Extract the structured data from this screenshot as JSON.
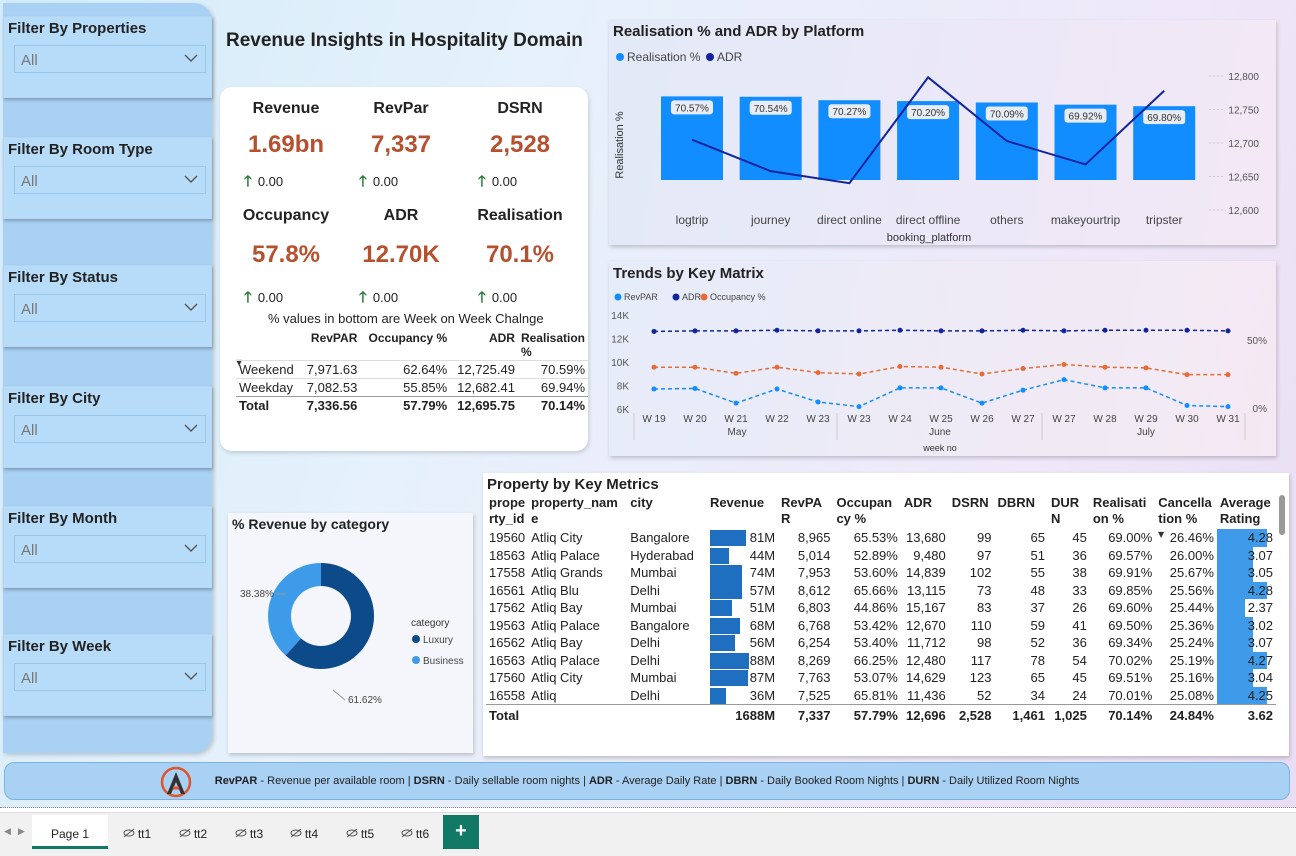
{
  "title": "Revenue Insights in Hospitality Domain",
  "filters": [
    {
      "label": "Filter By Properties",
      "value": "All"
    },
    {
      "label": "Filter By Room Type",
      "value": "All"
    },
    {
      "label": "Filter By Status",
      "value": "All"
    },
    {
      "label": "Filter By City",
      "value": "All"
    },
    {
      "label": "Filter By Month",
      "value": "All"
    },
    {
      "label": "Filter By Week",
      "value": "All"
    }
  ],
  "kpis": [
    {
      "label": "Revenue",
      "value": "1.69bn",
      "change": "0.00"
    },
    {
      "label": "RevPar",
      "value": "7,337",
      "change": "0.00"
    },
    {
      "label": "DSRN",
      "value": "2,528",
      "change": "0.00"
    },
    {
      "label": "Occupancy",
      "value": "57.8%",
      "change": "0.00"
    },
    {
      "label": "ADR",
      "value": "12.70K",
      "change": "0.00"
    },
    {
      "label": "Realisation",
      "value": "70.1%",
      "change": "0.00"
    }
  ],
  "kpi_note": "% values in bottom are Week on Week Chalnge",
  "daytype_table": {
    "headers": [
      "",
      "RevPAR",
      "Occupancy %",
      "ADR",
      "Realisation %"
    ],
    "rows": [
      [
        "Weekend",
        "7,971.63",
        "62.64%",
        "12,725.49",
        "70.59%"
      ],
      [
        "Weekday",
        "7,082.53",
        "55.85%",
        "12,682.41",
        "69.94%"
      ]
    ],
    "total": [
      "Total",
      "7,336.56",
      "57.79%",
      "12,695.75",
      "70.14%"
    ]
  },
  "colors": {
    "accent_blue": "#118dff",
    "dark_blue": "#12239e",
    "orange": "#e66c37",
    "kpi_value": "#b5512e"
  },
  "chart_data": [
    {
      "type": "bar",
      "title": "Realisation % and ADR by Platform",
      "xlabel": "booking_platform",
      "ylabel": "Realisation %",
      "categories": [
        "logtrip",
        "journey",
        "direct online",
        "direct offline",
        "others",
        "makeyourtrip",
        "tripster"
      ],
      "series": [
        {
          "name": "Realisation %",
          "type": "bar",
          "values": [
            70.57,
            70.54,
            70.27,
            70.2,
            70.09,
            69.92,
            69.8
          ],
          "labels": [
            "70.57%",
            "70.54%",
            "70.27%",
            "70.20%",
            "70.09%",
            "69.92%",
            "69.80%"
          ]
        },
        {
          "name": "ADR",
          "type": "line",
          "values": [
            12705,
            12658,
            12640,
            12798,
            12703,
            12668,
            12778
          ]
        }
      ],
      "y2_ticks": [
        "12,800",
        "12,750",
        "12,700",
        "12,650",
        "12,600"
      ],
      "y2lim": [
        12600,
        12800
      ],
      "legend": "top-left"
    },
    {
      "type": "line",
      "title": "Trends by Key Matrix",
      "xlabel": "week no",
      "x": [
        "W 19",
        "W 20",
        "W 21",
        "W 22",
        "W 23",
        "W 23",
        "W 24",
        "W 25",
        "W 26",
        "W 27",
        "W 27",
        "W 28",
        "W 29",
        "W 30",
        "W 31"
      ],
      "x_groups": [
        "May",
        "June",
        "July"
      ],
      "y_ticks": [
        "14K",
        "12K",
        "10K",
        "8K",
        "6K"
      ],
      "ylim": [
        6000,
        14000
      ],
      "y2_ticks": [
        "50%",
        "0%"
      ],
      "series": [
        {
          "name": "RevPAR",
          "values": [
            7700,
            7750,
            6500,
            7700,
            6600,
            6200,
            7800,
            7800,
            6500,
            7600,
            8500,
            7800,
            7800,
            6300,
            6200
          ]
        },
        {
          "name": "ADR",
          "values": [
            12600,
            12650,
            12650,
            12700,
            12650,
            12650,
            12700,
            12650,
            12650,
            12700,
            12650,
            12700,
            12700,
            12700,
            12650
          ]
        },
        {
          "name": "Occupancy %",
          "values": [
            60,
            60,
            51,
            60,
            52,
            50,
            61,
            60,
            50,
            58,
            64,
            60,
            59,
            49,
            49
          ]
        }
      ],
      "legend": "top-left"
    },
    {
      "type": "pie",
      "title": "% Revenue by category",
      "legend_title": "category",
      "categories": [
        "Luxury",
        "Business"
      ],
      "values": [
        61.62,
        38.38
      ],
      "labels": [
        "61.62%",
        "38.38%"
      ],
      "colors": [
        "#0c4a8a",
        "#3d9be9"
      ]
    }
  ],
  "property_table": {
    "title": "Property by Key Metrics",
    "headers": [
      "property_id",
      "property_name",
      "city",
      "Revenue",
      "RevPAR",
      "Occupancy %",
      "ADR",
      "DSRN",
      "DBRN",
      "DURN",
      "Realisation %",
      "Cancellation %",
      "Average Rating"
    ],
    "rows": [
      [
        "19560",
        "Atliq City",
        "Bangalore",
        "81M",
        "8,965",
        "65.53%",
        "13,680",
        "99",
        "65",
        "45",
        "69.00%",
        "26.46%",
        "4.28"
      ],
      [
        "18563",
        "Atliq Palace",
        "Hyderabad",
        "44M",
        "5,014",
        "52.89%",
        "9,480",
        "97",
        "51",
        "36",
        "69.57%",
        "26.00%",
        "3.07"
      ],
      [
        "17558",
        "Atliq Grands",
        "Mumbai",
        "74M",
        "7,953",
        "53.60%",
        "14,839",
        "102",
        "55",
        "38",
        "69.91%",
        "25.67%",
        "3.05"
      ],
      [
        "16561",
        "Atliq Blu",
        "Delhi",
        "57M",
        "8,612",
        "65.66%",
        "13,115",
        "73",
        "48",
        "33",
        "69.85%",
        "25.56%",
        "4.28"
      ],
      [
        "17562",
        "Atliq Bay",
        "Mumbai",
        "51M",
        "6,803",
        "44.86%",
        "15,167",
        "83",
        "37",
        "26",
        "69.60%",
        "25.44%",
        "2.37"
      ],
      [
        "19563",
        "Atliq Palace",
        "Bangalore",
        "68M",
        "6,768",
        "53.42%",
        "12,670",
        "110",
        "59",
        "41",
        "69.50%",
        "25.36%",
        "3.02"
      ],
      [
        "16562",
        "Atliq Bay",
        "Delhi",
        "56M",
        "6,254",
        "53.40%",
        "11,712",
        "98",
        "52",
        "36",
        "69.34%",
        "25.24%",
        "3.07"
      ],
      [
        "16563",
        "Atliq Palace",
        "Delhi",
        "88M",
        "8,269",
        "66.25%",
        "12,480",
        "117",
        "78",
        "54",
        "70.02%",
        "25.19%",
        "4.27"
      ],
      [
        "17560",
        "Atliq City",
        "Mumbai",
        "87M",
        "7,763",
        "53.07%",
        "14,629",
        "123",
        "65",
        "45",
        "69.51%",
        "25.16%",
        "3.04"
      ],
      [
        "16558",
        "Atliq",
        "Delhi",
        "36M",
        "7,525",
        "65.81%",
        "11,436",
        "52",
        "34",
        "24",
        "70.01%",
        "25.08%",
        "4.25"
      ]
    ],
    "revenue_fraction": [
      0.81,
      0.44,
      0.74,
      0.57,
      0.51,
      0.68,
      0.56,
      0.88,
      0.87,
      0.36
    ],
    "rating_fraction": [
      0.856,
      0.614,
      0.61,
      0.856,
      0.474,
      0.604,
      0.614,
      0.854,
      0.608,
      0.85
    ],
    "total": [
      "Total",
      "",
      "",
      "1688M",
      "7,337",
      "57.79%",
      "12,696",
      "2,528",
      "1,461",
      "1,025",
      "70.14%",
      "24.84%",
      "3.62"
    ]
  },
  "footer": {
    "parts": [
      {
        "b": "RevPAR",
        "t": " - Revenue per available room | "
      },
      {
        "b": "DSRN",
        "t": " - Daily sellable room nights | "
      },
      {
        "b": "ADR",
        "t": " - Average Daily Rate | "
      },
      {
        "b": "DBRN",
        "t": " - Daily Booked Room Nights | "
      },
      {
        "b": "DURN",
        "t": " - Daily Utilized Room Nights"
      }
    ]
  },
  "tabs": [
    "Page 1",
    "tt1",
    "tt2",
    "tt3",
    "tt4",
    "tt5",
    "tt6"
  ],
  "add_tab": "+"
}
